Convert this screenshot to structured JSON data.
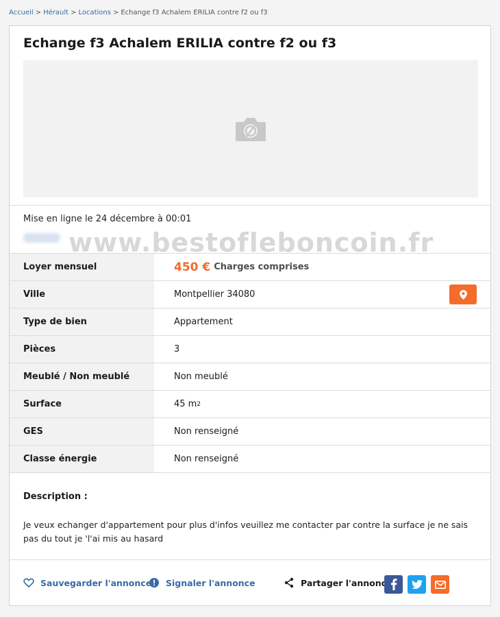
{
  "breadcrumb": {
    "items": [
      "Accueil",
      "Hérault",
      "Locations"
    ],
    "current": "Echange f3 Achalem ERILIA contre f2 ou f3",
    "separator": ">"
  },
  "listing": {
    "title": "Echange f3 Achalem ERILIA contre f2 ou f3",
    "photo_icon": "camera-off-icon",
    "posted": "Mise en ligne le 24 décembre à 00:01",
    "watermark": "www.bestofleboncoin.fr"
  },
  "attributes": [
    {
      "label": "Loyer mensuel",
      "price": "450 €",
      "price_note": "Charges comprises"
    },
    {
      "label": "Ville",
      "value": "Montpellier 34080",
      "icon": "map-pin-icon"
    },
    {
      "label": "Type de bien",
      "value": "Appartement"
    },
    {
      "label": "Pièces",
      "value": "3"
    },
    {
      "label": "Meublé / Non meublé",
      "value": "Non meublé"
    },
    {
      "label": "Surface",
      "value": "45 m",
      "unit_sup": "2"
    },
    {
      "label": "GES",
      "value": "Non renseigné"
    },
    {
      "label": "Classe énergie",
      "value": "Non renseigné"
    }
  ],
  "description": {
    "title": "Description :",
    "text": "Je veux echanger d'appartement pour plus d'infos veuillez me contacter par contre la surface je ne sais pas du tout je 'l'ai mis au hasard"
  },
  "actions": {
    "save": "Sauvegarder l'annonce",
    "report": "Signaler l'annonce",
    "share": "Partager l'annonce",
    "social": [
      "facebook-icon",
      "twitter-icon",
      "email-icon"
    ]
  },
  "colors": {
    "accent": "#f56b2a",
    "link": "#3a6aa6",
    "facebook": "#3b5998",
    "twitter": "#1da1f2",
    "email": "#f56b2a"
  }
}
